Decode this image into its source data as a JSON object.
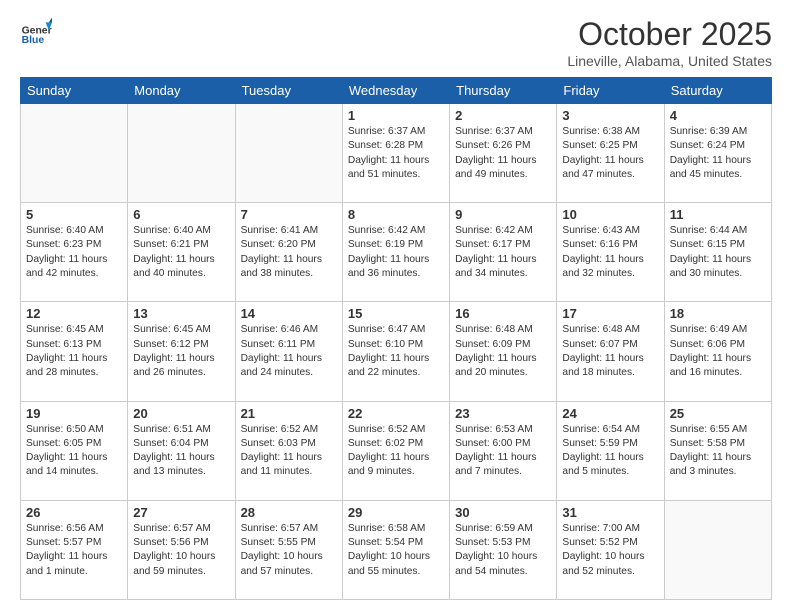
{
  "header": {
    "logo_general": "General",
    "logo_blue": "Blue",
    "month_title": "October 2025",
    "location": "Lineville, Alabama, United States"
  },
  "days_of_week": [
    "Sunday",
    "Monday",
    "Tuesday",
    "Wednesday",
    "Thursday",
    "Friday",
    "Saturday"
  ],
  "weeks": [
    [
      {
        "day": "",
        "text": ""
      },
      {
        "day": "",
        "text": ""
      },
      {
        "day": "",
        "text": ""
      },
      {
        "day": "1",
        "text": "Sunrise: 6:37 AM\nSunset: 6:28 PM\nDaylight: 11 hours\nand 51 minutes."
      },
      {
        "day": "2",
        "text": "Sunrise: 6:37 AM\nSunset: 6:26 PM\nDaylight: 11 hours\nand 49 minutes."
      },
      {
        "day": "3",
        "text": "Sunrise: 6:38 AM\nSunset: 6:25 PM\nDaylight: 11 hours\nand 47 minutes."
      },
      {
        "day": "4",
        "text": "Sunrise: 6:39 AM\nSunset: 6:24 PM\nDaylight: 11 hours\nand 45 minutes."
      }
    ],
    [
      {
        "day": "5",
        "text": "Sunrise: 6:40 AM\nSunset: 6:23 PM\nDaylight: 11 hours\nand 42 minutes."
      },
      {
        "day": "6",
        "text": "Sunrise: 6:40 AM\nSunset: 6:21 PM\nDaylight: 11 hours\nand 40 minutes."
      },
      {
        "day": "7",
        "text": "Sunrise: 6:41 AM\nSunset: 6:20 PM\nDaylight: 11 hours\nand 38 minutes."
      },
      {
        "day": "8",
        "text": "Sunrise: 6:42 AM\nSunset: 6:19 PM\nDaylight: 11 hours\nand 36 minutes."
      },
      {
        "day": "9",
        "text": "Sunrise: 6:42 AM\nSunset: 6:17 PM\nDaylight: 11 hours\nand 34 minutes."
      },
      {
        "day": "10",
        "text": "Sunrise: 6:43 AM\nSunset: 6:16 PM\nDaylight: 11 hours\nand 32 minutes."
      },
      {
        "day": "11",
        "text": "Sunrise: 6:44 AM\nSunset: 6:15 PM\nDaylight: 11 hours\nand 30 minutes."
      }
    ],
    [
      {
        "day": "12",
        "text": "Sunrise: 6:45 AM\nSunset: 6:13 PM\nDaylight: 11 hours\nand 28 minutes."
      },
      {
        "day": "13",
        "text": "Sunrise: 6:45 AM\nSunset: 6:12 PM\nDaylight: 11 hours\nand 26 minutes."
      },
      {
        "day": "14",
        "text": "Sunrise: 6:46 AM\nSunset: 6:11 PM\nDaylight: 11 hours\nand 24 minutes."
      },
      {
        "day": "15",
        "text": "Sunrise: 6:47 AM\nSunset: 6:10 PM\nDaylight: 11 hours\nand 22 minutes."
      },
      {
        "day": "16",
        "text": "Sunrise: 6:48 AM\nSunset: 6:09 PM\nDaylight: 11 hours\nand 20 minutes."
      },
      {
        "day": "17",
        "text": "Sunrise: 6:48 AM\nSunset: 6:07 PM\nDaylight: 11 hours\nand 18 minutes."
      },
      {
        "day": "18",
        "text": "Sunrise: 6:49 AM\nSunset: 6:06 PM\nDaylight: 11 hours\nand 16 minutes."
      }
    ],
    [
      {
        "day": "19",
        "text": "Sunrise: 6:50 AM\nSunset: 6:05 PM\nDaylight: 11 hours\nand 14 minutes."
      },
      {
        "day": "20",
        "text": "Sunrise: 6:51 AM\nSunset: 6:04 PM\nDaylight: 11 hours\nand 13 minutes."
      },
      {
        "day": "21",
        "text": "Sunrise: 6:52 AM\nSunset: 6:03 PM\nDaylight: 11 hours\nand 11 minutes."
      },
      {
        "day": "22",
        "text": "Sunrise: 6:52 AM\nSunset: 6:02 PM\nDaylight: 11 hours\nand 9 minutes."
      },
      {
        "day": "23",
        "text": "Sunrise: 6:53 AM\nSunset: 6:00 PM\nDaylight: 11 hours\nand 7 minutes."
      },
      {
        "day": "24",
        "text": "Sunrise: 6:54 AM\nSunset: 5:59 PM\nDaylight: 11 hours\nand 5 minutes."
      },
      {
        "day": "25",
        "text": "Sunrise: 6:55 AM\nSunset: 5:58 PM\nDaylight: 11 hours\nand 3 minutes."
      }
    ],
    [
      {
        "day": "26",
        "text": "Sunrise: 6:56 AM\nSunset: 5:57 PM\nDaylight: 11 hours\nand 1 minute."
      },
      {
        "day": "27",
        "text": "Sunrise: 6:57 AM\nSunset: 5:56 PM\nDaylight: 10 hours\nand 59 minutes."
      },
      {
        "day": "28",
        "text": "Sunrise: 6:57 AM\nSunset: 5:55 PM\nDaylight: 10 hours\nand 57 minutes."
      },
      {
        "day": "29",
        "text": "Sunrise: 6:58 AM\nSunset: 5:54 PM\nDaylight: 10 hours\nand 55 minutes."
      },
      {
        "day": "30",
        "text": "Sunrise: 6:59 AM\nSunset: 5:53 PM\nDaylight: 10 hours\nand 54 minutes."
      },
      {
        "day": "31",
        "text": "Sunrise: 7:00 AM\nSunset: 5:52 PM\nDaylight: 10 hours\nand 52 minutes."
      },
      {
        "day": "",
        "text": ""
      }
    ]
  ]
}
